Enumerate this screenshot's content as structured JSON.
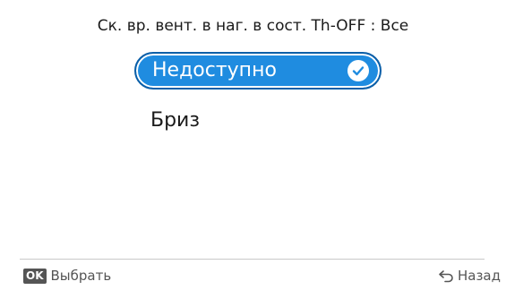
{
  "header": {
    "title": "Ск. вр. вент. в наг. в сост. Th-OFF : Все"
  },
  "options": [
    {
      "label": "Недоступно",
      "selected": true
    },
    {
      "label": "Бриз",
      "selected": false
    }
  ],
  "footer": {
    "ok_badge": "OK",
    "select_label": "Выбрать",
    "back_label": "Назад"
  },
  "colors": {
    "accent": "#1f8ce0",
    "accent_border": "#0b5fa8",
    "footer_text": "#555555"
  },
  "icons": {
    "selected_check": "check-circle-icon",
    "back": "undo-arrow-icon"
  }
}
